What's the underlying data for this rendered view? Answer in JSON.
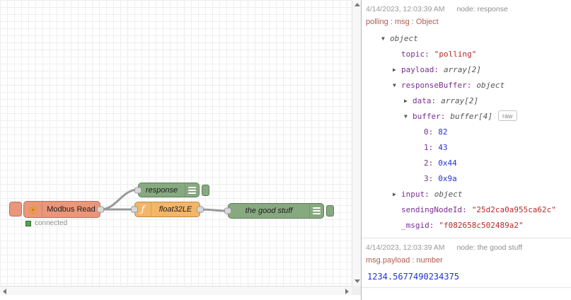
{
  "flow": {
    "nodes": {
      "modbus": {
        "label": "Modbus Read",
        "status_text": "connected"
      },
      "response": {
        "label": "response"
      },
      "float32": {
        "label": "float32LE",
        "icon_glyph": "ƒ"
      },
      "good_stuff": {
        "label": "the good stuff"
      }
    }
  },
  "debug": {
    "messages": [
      {
        "timestamp": "4/14/2023, 12:03:39 AM",
        "source": "node: response",
        "meta": "polling : msg : Object",
        "tree": [
          {
            "key": "",
            "type": "object",
            "expander": "expanded"
          },
          {
            "key": "topic",
            "value": "\"polling\"",
            "value_kind": "string"
          },
          {
            "key": "payload",
            "type": "array[2]",
            "expander": "collapsed"
          },
          {
            "key": "responseBuffer",
            "type": "object",
            "expander": "expanded"
          },
          {
            "key": "data",
            "type": "array[2]",
            "expander": "collapsed"
          },
          {
            "key": "buffer",
            "type": "buffer[4]",
            "expander": "expanded",
            "raw_button": "raw"
          },
          {
            "key": "0",
            "value": "82",
            "value_kind": "number"
          },
          {
            "key": "1",
            "value": "43",
            "value_kind": "number"
          },
          {
            "key": "2",
            "value": "0x44",
            "value_kind": "number"
          },
          {
            "key": "3",
            "value": "0x9a",
            "value_kind": "number"
          },
          {
            "key": "input",
            "type": "object",
            "expander": "collapsed"
          },
          {
            "key": "sendingNodeId",
            "value": "\"25d2ca0a955ca62c\"",
            "value_kind": "string"
          },
          {
            "key": "_msgid",
            "value": "\"f082658c502489a2\"",
            "value_kind": "string"
          }
        ]
      },
      {
        "timestamp": "4/14/2023, 12:03:39 AM",
        "source": "node: the good stuff",
        "meta": "msg.payload : number",
        "value": "1234.5677490234375"
      }
    ]
  },
  "colors": {
    "modbus_node": "#E9967A",
    "debug_node": "#87a980",
    "function_node": "#f3b567",
    "wire": "#999999",
    "key_text": "#792e90",
    "string_value": "#b72828",
    "number_value": "#2033d6",
    "meta_text": "#b25b4e",
    "status_green": "#55a055"
  }
}
